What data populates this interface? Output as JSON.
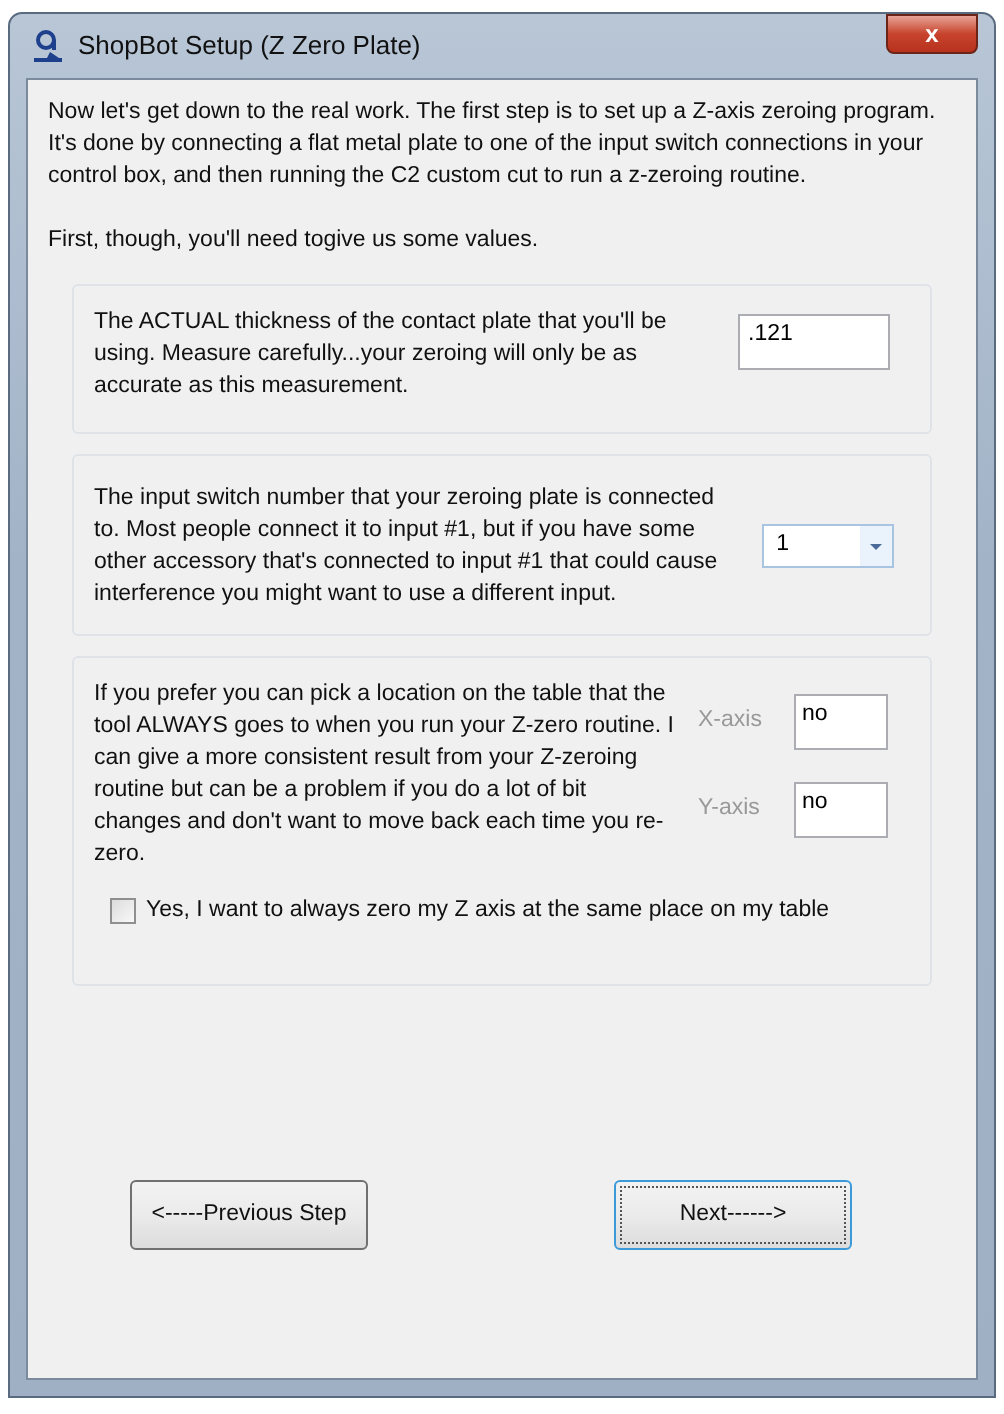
{
  "window": {
    "title": "ShopBot Setup (Z Zero Plate)",
    "close": "x"
  },
  "intro": [
    "Now let's get down to the real work. The first step is to set up a Z-axis zeroing program. It's done by connecting a flat metal plate to one of the input switch connections in your control box, and then running the C2 custom cut to run a z-zeroing routine.",
    "First, though, you'll need togive us some values."
  ],
  "thickness": {
    "text": "The ACTUAL thickness of the contact plate that you'll be using. Measure carefully...your zeroing will only be as accurate as this measurement.",
    "value": ".121"
  },
  "input_switch": {
    "text": "The input switch number that your zeroing plate is connected to. Most people connect it to input #1, but if you have some other accessory that's connected to input #1 that could cause interference you might want to use a different input.",
    "value": "1"
  },
  "location": {
    "text": "If you prefer you can pick a location on the table that the tool ALWAYS  goes to when you run your Z-zero routine. I can give a more consistent result from your Z-zeroing routine but can be a problem if you do a lot of bit changes and don't want to move back each time you re-zero.",
    "fields": [
      {
        "label": "X-axis",
        "value": "no"
      },
      {
        "label": "Y-axis",
        "value": "no"
      }
    ],
    "checkbox": {
      "label": "Yes, I want to always zero my Z axis at the same place on my table",
      "checked": false
    }
  },
  "buttons": [
    {
      "label": "<-----Previous Step",
      "focused": false
    },
    {
      "label": "Next------>",
      "focused": true
    }
  ]
}
